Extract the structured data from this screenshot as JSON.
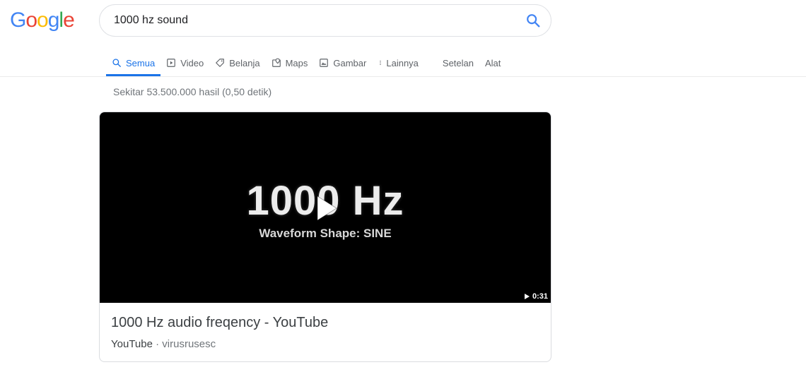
{
  "logo": {
    "letters": [
      {
        "ch": "G",
        "color": "#4285F4"
      },
      {
        "ch": "o",
        "color": "#EA4335"
      },
      {
        "ch": "o",
        "color": "#FBBC05"
      },
      {
        "ch": "g",
        "color": "#4285F4"
      },
      {
        "ch": "l",
        "color": "#34A853"
      },
      {
        "ch": "e",
        "color": "#EA4335"
      }
    ]
  },
  "search": {
    "value": "1000 hz sound",
    "icon": "search-icon"
  },
  "tabs": [
    {
      "label": "Semua",
      "icon": "search-icon",
      "active": true
    },
    {
      "label": "Video",
      "icon": "play-box-icon"
    },
    {
      "label": "Belanja",
      "icon": "tag-icon"
    },
    {
      "label": "Maps",
      "icon": "map-pin-icon"
    },
    {
      "label": "Gambar",
      "icon": "image-icon"
    },
    {
      "label": "Lainnya",
      "icon": "more-vert-icon"
    }
  ],
  "tools": {
    "settings_label": "Setelan",
    "tools_label": "Alat"
  },
  "result_stats": "Sekitar 53.500.000 hasil (0,50 detik)",
  "video": {
    "thumbnail_title": "1000 Hz",
    "thumbnail_subtitle": "Waveform Shape: SINE",
    "duration": "0:31",
    "title": "1000 Hz audio freqency - YouTube",
    "source": "YouTube",
    "separator": "·",
    "channel": "virusrusesc"
  },
  "colors": {
    "accent": "#1a73e8",
    "text_secondary": "#70757a"
  }
}
